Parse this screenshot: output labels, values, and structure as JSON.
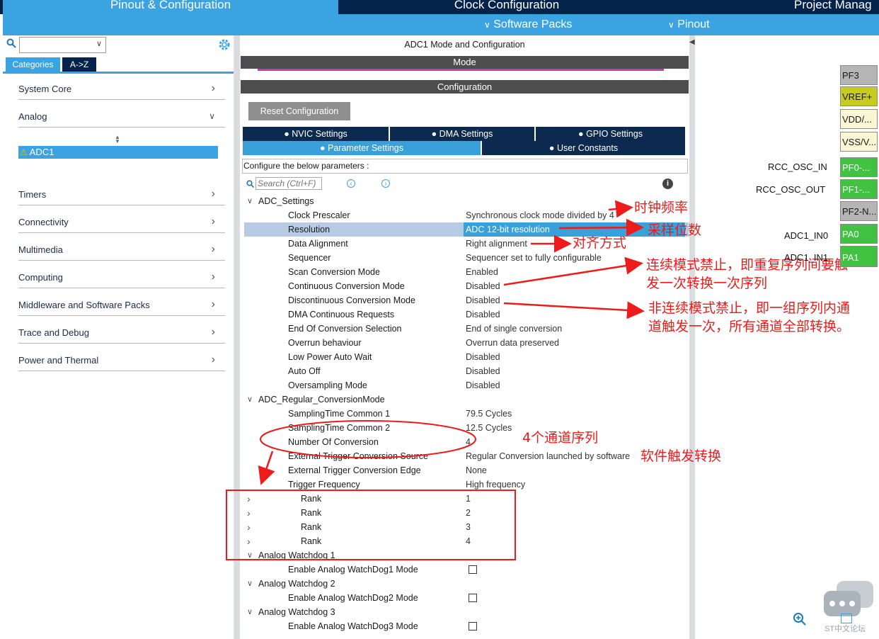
{
  "top_tabs": [
    "Pinout & Configuration",
    "Clock Configuration",
    "Project Manag"
  ],
  "sub_menu": {
    "software_packs": "Software Packs",
    "pinout": "Pinout"
  },
  "left": {
    "tab_categories": "Categories",
    "tab_az": "A->Z",
    "categories": [
      "System Core",
      "Analog",
      "Timers",
      "Connectivity",
      "Multimedia",
      "Computing",
      "Middleware and Software Packs",
      "Trace and Debug",
      "Power and Thermal"
    ],
    "analog_item": "ADC1"
  },
  "middle": {
    "title": "ADC1 Mode and Configuration",
    "mode_header": "Mode",
    "config_header": "Configuration",
    "reset_button": "Reset Configuration",
    "tabs": {
      "nvic": "NVIC Settings",
      "dma": "DMA Settings",
      "gpio": "GPIO Settings",
      "params": "Parameter Settings",
      "user": "User Constants"
    },
    "configure_text": "Configure the below parameters :",
    "search_placeholder": "Search (Ctrl+F)",
    "groups": {
      "adc_settings": "ADC_Settings",
      "regular": "ADC_Regular_ConversionMode",
      "wd1": "Analog Watchdog 1",
      "wd2": "Analog Watchdog 2",
      "wd3": "Analog Watchdog 3"
    },
    "adc_settings": [
      {
        "label": "Clock Prescaler",
        "value": "Synchronous clock mode divided by 4"
      },
      {
        "label": "Resolution",
        "value": "ADC 12-bit resolution"
      },
      {
        "label": "Data Alignment",
        "value": "Right alignment"
      },
      {
        "label": "Sequencer",
        "value": "Sequencer set to fully configurable"
      },
      {
        "label": "Scan Conversion Mode",
        "value": "Enabled"
      },
      {
        "label": "Continuous Conversion Mode",
        "value": "Disabled"
      },
      {
        "label": "Discontinuous Conversion Mode",
        "value": "Disabled"
      },
      {
        "label": "DMA Continuous Requests",
        "value": "Disabled"
      },
      {
        "label": "End Of Conversion Selection",
        "value": "End of single conversion"
      },
      {
        "label": "Overrun behaviour",
        "value": "Overrun data preserved"
      },
      {
        "label": "Low Power Auto Wait",
        "value": "Disabled"
      },
      {
        "label": "Auto Off",
        "value": "Disabled"
      },
      {
        "label": "Oversampling Mode",
        "value": "Disabled"
      }
    ],
    "regular": [
      {
        "label": "SamplingTime Common 1",
        "value": "79.5 Cycles"
      },
      {
        "label": "SamplingTime Common 2",
        "value": "12.5 Cycles"
      },
      {
        "label": "Number Of Conversion",
        "value": "4"
      },
      {
        "label": "External Trigger Conversion Source",
        "value": "Regular Conversion launched by software"
      },
      {
        "label": "External Trigger Conversion Edge",
        "value": "None"
      },
      {
        "label": "Trigger Frequency",
        "value": "High frequency"
      }
    ],
    "ranks": [
      {
        "label": "Rank",
        "value": "1"
      },
      {
        "label": "Rank",
        "value": "2"
      },
      {
        "label": "Rank",
        "value": "3"
      },
      {
        "label": "Rank",
        "value": "4"
      }
    ],
    "wd1_label": "Enable Analog WatchDog1 Mode",
    "wd2_label": "Enable Analog WatchDog2 Mode",
    "wd3_label": "Enable Analog WatchDog3 Mode"
  },
  "annotations": {
    "clock": "时钟频率",
    "resolution": "采样位数",
    "alignment": "对齐方式",
    "continuous_line1": "连续模式禁止，即重复序列间要触",
    "continuous_line2": "发一次转换一次序列",
    "discontinuous_line1": "非连续模式禁止，即一组序列内通",
    "discontinuous_line2": "道触发一次，所有通道全部转换。",
    "channels": "4个通道序列",
    "software": "软件触发转换"
  },
  "pins": {
    "pf3": "PF3",
    "vref": "VREF+",
    "vdd": "VDD/...",
    "vss": "VSS/V...",
    "pf0": "PF0-...",
    "pf1": "PF1-...",
    "pf2": "PF2-N...",
    "pa0": "PA0",
    "pa1": "PA1",
    "rcc_in": "RCC_OSC_IN",
    "rcc_out": "RCC_OSC_OUT",
    "adc_in0": "ADC1_IN0",
    "adc_in1": "ADC1_IN1"
  },
  "watermark": "ST中文论坛",
  "colors": {
    "accent": "#3ba3e1",
    "dark_tab": "#0c2a50",
    "header_gray": "#4d4d4d",
    "pin_green": "#41c241",
    "pin_yellow": "#c8cc1e",
    "annotation_red": "#ee1b1b",
    "warning": "#f5c000"
  }
}
